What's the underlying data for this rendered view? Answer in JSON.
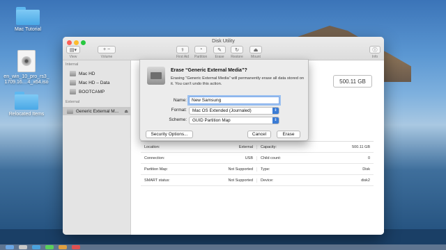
{
  "desktop": {
    "icons": [
      {
        "label": "Mac Tutorial",
        "type": "folder"
      },
      {
        "label": "en_win_10_pro_rs3_\n1709.16....4_x64.iso",
        "type": "iso"
      },
      {
        "label": "Relocated Items",
        "type": "folder"
      }
    ]
  },
  "window": {
    "title": "Disk Utility",
    "toolbar": {
      "view_label": "View",
      "volume_label": "Volume",
      "first_aid_label": "First Aid",
      "partition_label": "Partition",
      "erase_label": "Erase",
      "restore_label": "Restore",
      "mount_label": "Mount",
      "info_label": "Info"
    },
    "sidebar": {
      "internal_header": "Internal",
      "internal_items": [
        "Mac HD",
        "Mac HD – Data",
        "BOOTCAMP"
      ],
      "external_header": "External",
      "external_items": [
        "Generic External M..."
      ]
    },
    "capacity_display": "500.11 GB",
    "info_table": [
      {
        "left_label": "Location:",
        "left_value": "External",
        "right_label": "Capacity:",
        "right_value": "500.11 GB"
      },
      {
        "left_label": "Connection:",
        "left_value": "USB",
        "right_label": "Child count:",
        "right_value": "0"
      },
      {
        "left_label": "Partition Map:",
        "left_value": "Not Supported",
        "right_label": "Type:",
        "right_value": "Disk"
      },
      {
        "left_label": "SMART status:",
        "left_value": "Not Supported",
        "right_label": "Device:",
        "right_value": "disk2"
      }
    ]
  },
  "sheet": {
    "title": "Erase “Generic External Media”?",
    "description": "Erasing “Generic External Media” will permanently erase all data stored on it. You can’t undo this action.",
    "name_label": "Name:",
    "name_value": "New Samsung",
    "format_label": "Format:",
    "format_value": "Mac OS Extended (Journaled)",
    "scheme_label": "Scheme:",
    "scheme_value": "GUID Partition Map",
    "security_button": "Security Options...",
    "cancel_button": "Cancel",
    "erase_button": "Erase"
  },
  "colors": {
    "close": "#fc5f57",
    "minimize": "#fdbc2e",
    "zoom": "#28c840",
    "accent": "#3a7bd5"
  }
}
